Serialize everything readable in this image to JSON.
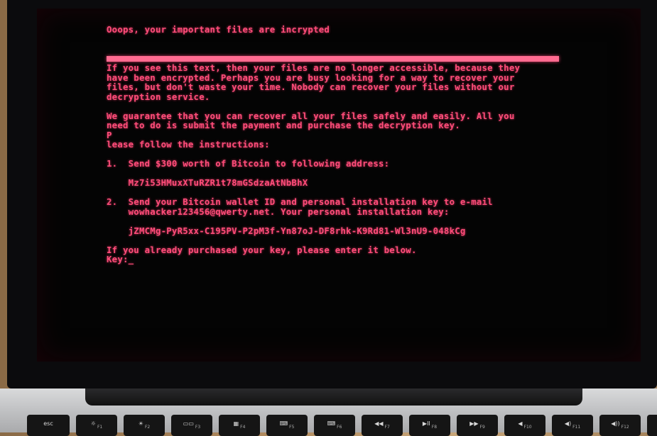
{
  "ransom_note": {
    "heading": "Ooops, your important files are incrypted",
    "para1": [
      "If you see this text, then your files are no longer accessible, because they",
      "have been encrypted. Perhaps you are busy looking for a way to recover your",
      "files, but don't waste your time. Nobody can recover your files without our",
      "decryption service."
    ],
    "para2": [
      "We guarantee that you can recover all your files safely and easily. All you",
      "need to do is submit the payment and purchase the decryption key.",
      "P",
      "lease follow the instructions:"
    ],
    "step1": "1.  Send $300 worth of Bitcoin to following address:",
    "bitcoin_address": "    Mz7i53HMuxXTuRZR1t78mGSdzaAtNbBhX",
    "step2_line1": "2.  Send your Bitcoin wallet ID and personal installation key to e-mail",
    "step2_line2": "    wowhacker123456@qwerty.net. Your personal installation key:",
    "installation_key": "    jZMCMg-PyR5xx-C195PV-P2pM3f-Yn87oJ-DF8rhk-K9Rd81-Wl3nU9-048kCg",
    "outro": "If you already purchased your key, please enter it below.",
    "key_prompt": "Key:",
    "cursor": "_"
  },
  "keyboard": {
    "keys": [
      {
        "label": "esc",
        "fn": ""
      },
      {
        "label": "☼",
        "fn": "F1"
      },
      {
        "label": "☀",
        "fn": "F2"
      },
      {
        "label": "▭▭",
        "fn": "F3"
      },
      {
        "label": "▦",
        "fn": "F4"
      },
      {
        "label": "⌨",
        "fn": "F5"
      },
      {
        "label": "⌨",
        "fn": "F6"
      },
      {
        "label": "◀◀",
        "fn": "F7"
      },
      {
        "label": "▶II",
        "fn": "F8"
      },
      {
        "label": "▶▶",
        "fn": "F9"
      },
      {
        "label": "◀",
        "fn": "F10"
      },
      {
        "label": "◀)",
        "fn": "F11"
      },
      {
        "label": "◀))",
        "fn": "F12"
      },
      {
        "label": "⏻",
        "fn": ""
      }
    ]
  }
}
